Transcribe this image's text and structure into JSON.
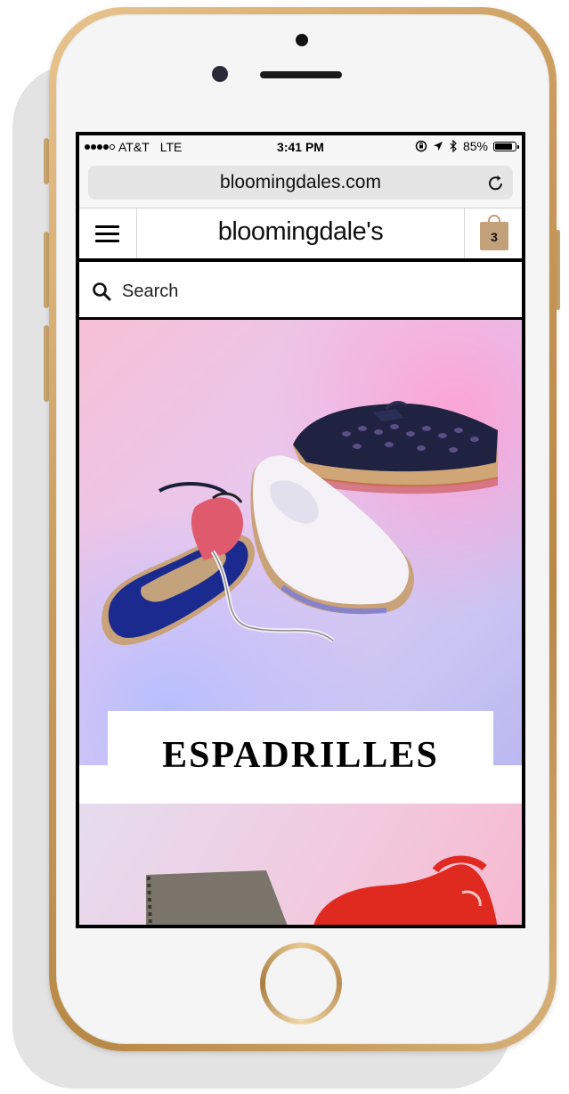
{
  "status_bar": {
    "carrier": "AT&T",
    "network": "LTE",
    "time": "3:41 PM",
    "battery": "85%",
    "battery_level": 0.85
  },
  "browser": {
    "url": "bloomingdales.com",
    "reload_icon": "reload-icon"
  },
  "header": {
    "logo": "bloomingdale's",
    "menu_icon": "hamburger-menu-icon",
    "bag_count": "3"
  },
  "search": {
    "placeholder": "Search"
  },
  "hero": {
    "title": "ESPADRILLES"
  },
  "colors": {
    "frame_gold": "#c99a5a",
    "bag": "#c2a07a",
    "text": "#000000"
  }
}
